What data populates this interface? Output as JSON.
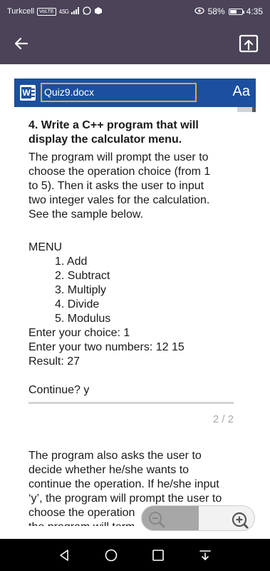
{
  "status_bar": {
    "carrier": "Turkcell",
    "network_badge": "VoLTE",
    "signal_label": "4.5G",
    "battery_percent_text": "58%",
    "battery_level": 0.58,
    "time": "4:35",
    "icons": [
      "whatsapp-icon",
      "app-icon",
      "eye-icon",
      "battery-icon"
    ]
  },
  "app_bar": {
    "back_icon": "arrow-left-icon",
    "share_icon": "upload-icon"
  },
  "word_header": {
    "filename": "Quiz9.docx",
    "text_size_label": "Aa",
    "accent_color": "#1b4fa0",
    "field_border_color": "#e4a93a"
  },
  "document": {
    "question_title_lines": [
      "4. Write a C++ program that will",
      "display the calculator menu."
    ],
    "intro_lines": [
      "The program will prompt the user to",
      "choose the operation choice (from 1",
      "to 5). Then it asks the user to input",
      "two integer vales for the calculation.",
      "See the sample below."
    ],
    "menu_heading": "MENU",
    "menu_items": [
      "1. Add",
      "2. Subtract",
      "3. Multiply",
      "4. Divide",
      "5. Modulus"
    ],
    "sample_lines": [
      "Enter your choice: 1",
      "Enter your two numbers: 12 15",
      "Result: 27"
    ],
    "continue_line": "Continue? y",
    "page_indicator": "2 / 2",
    "continuation_lines": [
      "The program also asks the user to",
      "decide whether he/she wants to",
      "continue the operation. If he/she input",
      "‘y’, the program will prompt the user to",
      "choose the operation",
      "the program will term"
    ]
  },
  "zoom": {
    "zoom_out_icon": "zoom-out-icon",
    "zoom_in_icon": "zoom-in-icon"
  },
  "nav_bar": {
    "icons": [
      "back-triangle-icon",
      "home-circle-icon",
      "recents-square-icon",
      "notification-pull-icon"
    ]
  }
}
